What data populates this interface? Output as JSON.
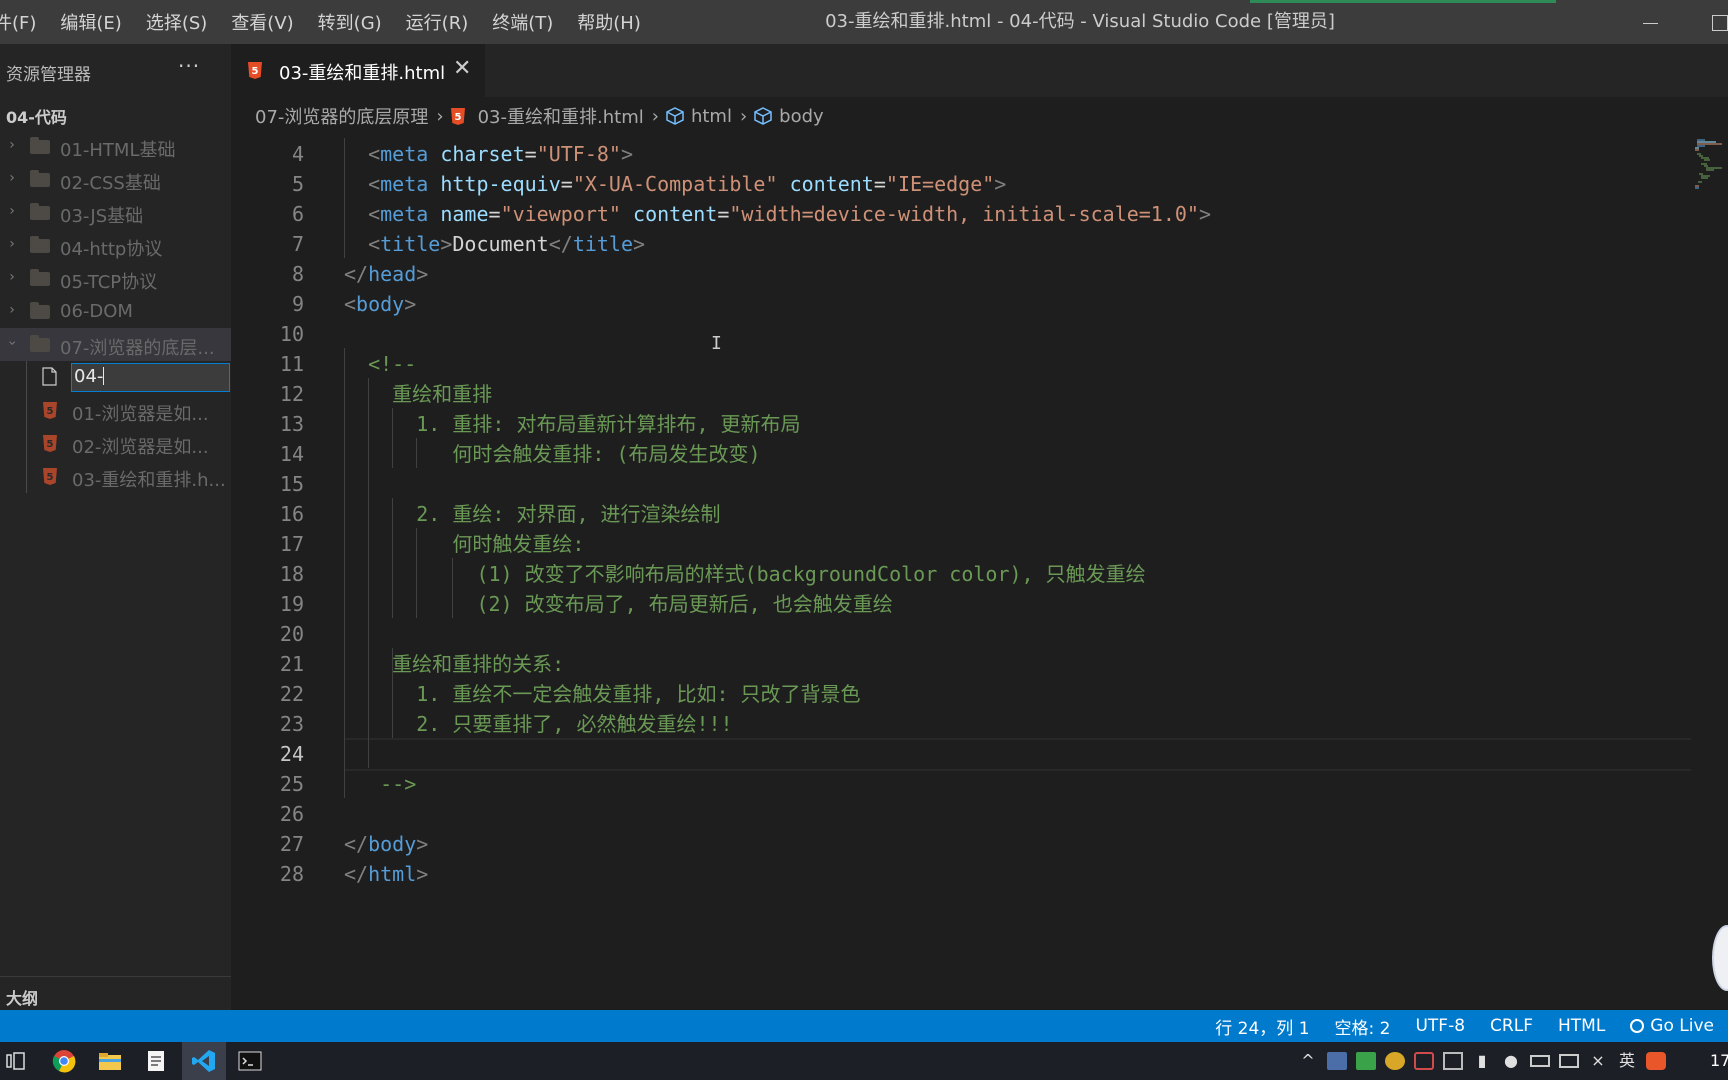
{
  "menu": [
    "件(F)",
    "编辑(E)",
    "选择(S)",
    "查看(V)",
    "转到(G)",
    "运行(R)",
    "终端(T)",
    "帮助(H)"
  ],
  "window_title": "03-重绘和重排.html - 04-代码 - Visual Studio Code [管理员]",
  "sidebar": {
    "title": "资源管理器",
    "more": "···",
    "workspace": "04-代码",
    "folders": [
      "01-HTML基础",
      "02-CSS基础",
      "03-JS基础",
      "04-http协议",
      "05-TCP协议",
      "06-DOM",
      "07-浏览器的底层..."
    ],
    "rename_value": "04-",
    "files": [
      "01-浏览器是如...",
      "02-浏览器是如...",
      "03-重绘和重排.h..."
    ],
    "outline_title": "大纲"
  },
  "tab": {
    "label": "03-重绘和重排.html",
    "close": "✕"
  },
  "breadcrumb": [
    "07-浏览器的底层原理",
    "03-重绘和重排.html",
    "html",
    "body"
  ],
  "code_lines": [
    {
      "n": "4",
      "code": "<meta charset=\"UTF-8\">"
    },
    {
      "n": "5",
      "code": "<meta http-equiv=\"X-UA-Compatible\" content=\"IE=edge\">"
    },
    {
      "n": "6",
      "code": "<meta name=\"viewport\" content=\"width=device-width, initial-scale=1.0\">"
    },
    {
      "n": "7",
      "code": "<title>Document</title>"
    },
    {
      "n": "8",
      "code": "</head>"
    },
    {
      "n": "9",
      "code": "<body>"
    },
    {
      "n": "10",
      "code": ""
    },
    {
      "n": "11",
      "code": "<!--"
    },
    {
      "n": "12",
      "code": "重绘和重排"
    },
    {
      "n": "13",
      "code": "1. 重排: 对布局重新计算排布, 更新布局"
    },
    {
      "n": "14",
      "code": "何时会触发重排: (布局发生改变)"
    },
    {
      "n": "15",
      "code": ""
    },
    {
      "n": "16",
      "code": "2. 重绘: 对界面, 进行渲染绘制"
    },
    {
      "n": "17",
      "code": "何时触发重绘:"
    },
    {
      "n": "18",
      "code": "(1) 改变了不影响布局的样式(backgroundColor color), 只触发重绘"
    },
    {
      "n": "19",
      "code": "(2) 改变布局了, 布局更新后, 也会触发重绘"
    },
    {
      "n": "20",
      "code": ""
    },
    {
      "n": "21",
      "code": "重绘和重排的关系:"
    },
    {
      "n": "22",
      "code": "1. 重绘不一定会触发重排, 比如: 只改了背景色"
    },
    {
      "n": "23",
      "code": "2. 只要重排了, 必然触发重绘!!!"
    },
    {
      "n": "24",
      "code": ""
    },
    {
      "n": "25",
      "code": "-->"
    },
    {
      "n": "26",
      "code": ""
    },
    {
      "n": "27",
      "code": "</body>"
    },
    {
      "n": "28",
      "code": "</html>"
    }
  ],
  "status": {
    "position": "行 24，列 1",
    "spaces": "空格: 2",
    "encoding": "UTF-8",
    "eol": "CRLF",
    "language": "HTML",
    "golive": "Go Live"
  },
  "tray": {
    "ime": "英",
    "clock": "17"
  },
  "colors": {
    "statusbar": "#007acc",
    "tag": "#569cd6",
    "attr": "#9cdcfe",
    "string": "#ce9178",
    "comment": "#6a9955"
  }
}
